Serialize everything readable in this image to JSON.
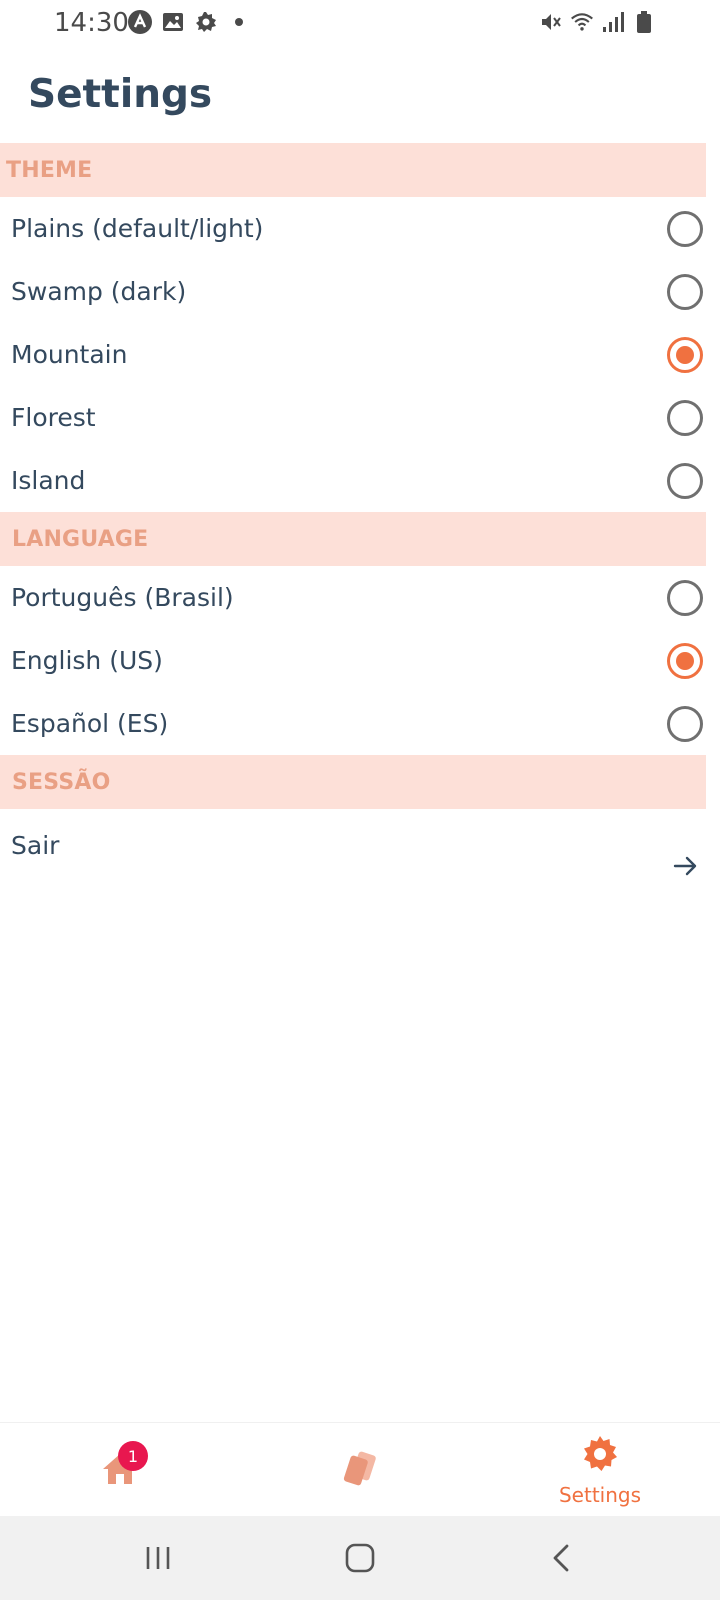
{
  "status_bar": {
    "time": "14:30",
    "left_icons": [
      "app-icon",
      "image-icon",
      "gear-icon",
      "dot-icon"
    ],
    "right_icons": [
      "mute-icon",
      "wifi-icon",
      "signal-icon",
      "battery-icon"
    ]
  },
  "header": {
    "title": "Settings"
  },
  "sections": {
    "theme": {
      "title": "THEME",
      "options": [
        {
          "label": "Plains (default/light)",
          "selected": false
        },
        {
          "label": "Swamp (dark)",
          "selected": false
        },
        {
          "label": "Mountain",
          "selected": true
        },
        {
          "label": "Florest",
          "selected": false
        },
        {
          "label": "Island",
          "selected": false
        }
      ]
    },
    "language": {
      "title": "LANGUAGE",
      "options": [
        {
          "label": "Português (Brasil)",
          "selected": false
        },
        {
          "label": "English (US)",
          "selected": true
        },
        {
          "label": "Español (ES)",
          "selected": false
        }
      ]
    },
    "session": {
      "title": "SESSÃO",
      "logout_label": "Sair"
    }
  },
  "bottom_nav": {
    "home": {
      "icon": "home-icon",
      "badge": "1"
    },
    "cards": {
      "icon": "cards-icon"
    },
    "settings": {
      "icon": "gear-icon",
      "label": "Settings",
      "active": true
    }
  },
  "colors": {
    "accent": "#f07140",
    "section_bg": "#fde0d8",
    "section_text": "#e9a084",
    "text": "#34495e",
    "badge": "#e8174f"
  }
}
